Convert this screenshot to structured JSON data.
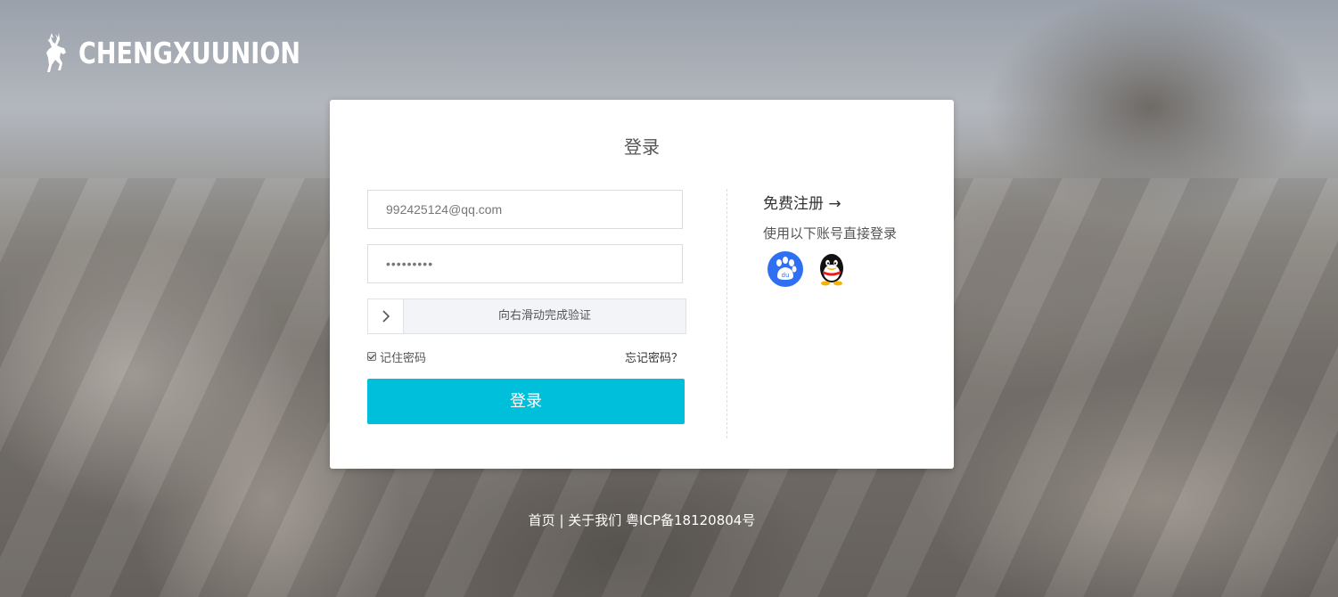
{
  "brand": {
    "name": "CHENGXUUNION",
    "logo_icon": "deer-icon"
  },
  "login": {
    "title": "登录",
    "email_value": "992425124@qq.com",
    "password_value": "•••••••••",
    "slider_text": "向右滑动完成验证",
    "remember_label": "记住密码",
    "remember_checked": true,
    "forgot_label": "忘记密码？",
    "submit_label": "登录"
  },
  "side": {
    "register_label": "免费注册 →",
    "other_login_label": "使用以下账号直接登录",
    "providers": [
      "baidu-icon",
      "qq-icon"
    ]
  },
  "footer": {
    "home": "首页",
    "sep1": " | ",
    "about": "关于我们",
    "icp": " 粤ICP备18120804号"
  },
  "colors": {
    "accent": "#00bfdb",
    "baidu": "#2f6ff1"
  }
}
